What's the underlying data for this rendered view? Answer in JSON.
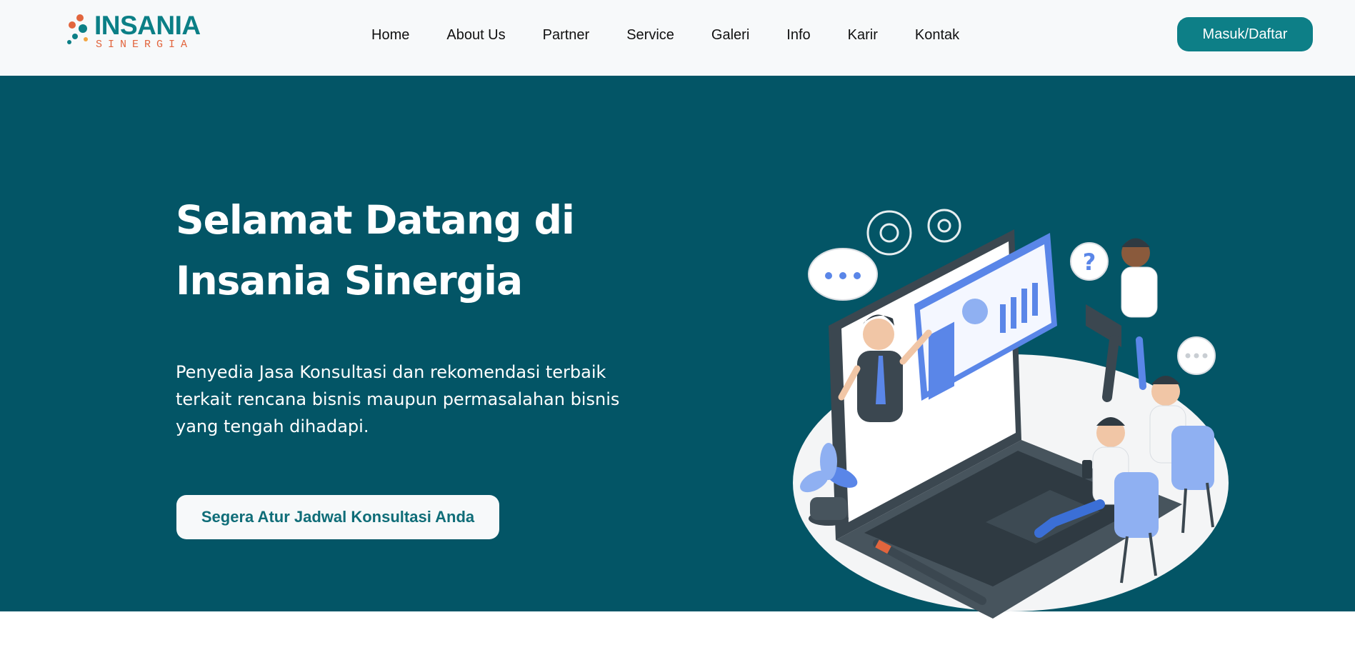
{
  "brand": {
    "name": "INSANIA",
    "tagline": "SINERGIA",
    "dot_colors": [
      "#e2653d",
      "#0b7f86",
      "#f2a541"
    ]
  },
  "nav": {
    "items": [
      {
        "label": "Home"
      },
      {
        "label": "About Us"
      },
      {
        "label": "Partner"
      },
      {
        "label": "Service"
      },
      {
        "label": "Galeri"
      },
      {
        "label": "Info"
      },
      {
        "label": "Karir"
      },
      {
        "label": "Kontak"
      }
    ],
    "login_label": "Masuk/Daftar"
  },
  "hero": {
    "title": "Selamat Datang di Insania Sinergia",
    "description": "Penyedia Jasa Konsultasi dan rekomendasi terbaik terkait rencana bisnis maupun permasalahan bisnis yang tengah dihadapi.",
    "cta_label": "Segera Atur Jadwal Konsultasi Anda",
    "illustration": "business-consultation-illustration"
  },
  "colors": {
    "header_bg": "#f7f9fa",
    "hero_bg": "#035566",
    "accent": "#0d7f87",
    "illustration_blue": "#5a86e8"
  }
}
